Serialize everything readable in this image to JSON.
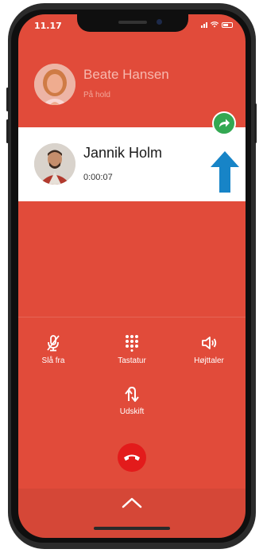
{
  "status_bar": {
    "time": "11.17",
    "icons": [
      "signal-icon",
      "wifi-icon",
      "battery-icon"
    ]
  },
  "held_call": {
    "name": "Beate Hansen",
    "status": "På hold",
    "avatar": "avatar-woman"
  },
  "active_call": {
    "name": "Jannik Holm",
    "duration": "0:00:07",
    "avatar": "avatar-man"
  },
  "transfer_button": {
    "icon": "forward-arrow-icon",
    "color": "#33a852"
  },
  "controls": {
    "mute": {
      "label": "Slå fra",
      "icon": "mic-off-icon"
    },
    "keypad": {
      "label": "Tastatur",
      "icon": "keypad-icon"
    },
    "speaker": {
      "label": "Højttaler",
      "icon": "speaker-icon"
    },
    "swap": {
      "label": "Udskift",
      "icon": "swap-icon"
    }
  },
  "hangup": {
    "icon": "phone-hangup-icon",
    "color": "#e31b1b"
  },
  "expand": {
    "icon": "chevron-up-icon"
  },
  "colors": {
    "background": "#e14b3a",
    "accent_arrow": "#1784c7"
  }
}
